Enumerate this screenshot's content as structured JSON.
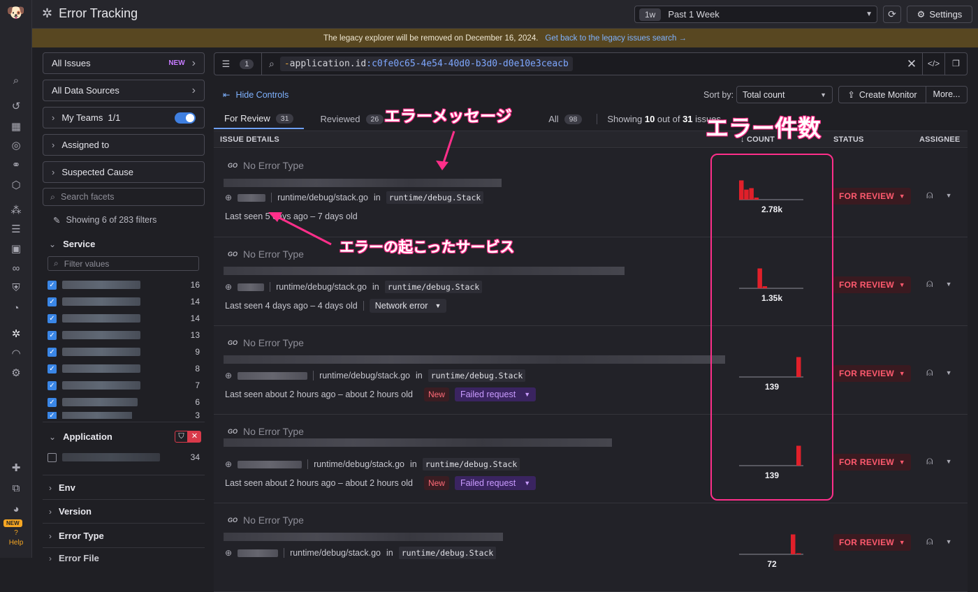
{
  "nav": {
    "new_badge": "NEW",
    "help_label": "Help",
    "icons": [
      "datadog-logo",
      "search-icon",
      "history-icon",
      "dashboard-icon",
      "target-icon",
      "binoculars-icon",
      "cube-icon",
      "service-icon",
      "logs-icon",
      "infra-icon",
      "link-icon",
      "security-icon",
      "apm-icon",
      "bug-icon",
      "gauge-icon",
      "synthetic-icon",
      "integrations-icon",
      "team-icon",
      "avatar"
    ]
  },
  "header": {
    "title": "Error Tracking",
    "time_pill": "1w",
    "time_label": "Past 1 Week",
    "settings_label": "Settings"
  },
  "banner": {
    "text": "The legacy explorer will be removed on December 16, 2024.",
    "link": "Get back to the legacy issues search →"
  },
  "sidebar": {
    "all_issues": "All Issues",
    "all_issues_badge": "NEW",
    "all_data_sources": "All Data Sources",
    "my_teams": "My Teams",
    "my_teams_count": "1/1",
    "assigned_to": "Assigned to",
    "suspected_cause": "Suspected Cause",
    "search_placeholder": "Search facets",
    "showing_filters": "Showing 6 of 283 filters",
    "service_label": "Service",
    "filter_placeholder": "Filter values",
    "service_counts": [
      "16",
      "14",
      "14",
      "13",
      "9",
      "8",
      "7",
      "6",
      "3"
    ],
    "application_label": "Application",
    "application_count": "34",
    "env_label": "Env",
    "version_label": "Version",
    "error_type_label": "Error Type",
    "error_file_label": "Error File"
  },
  "query": {
    "filter_count": "1",
    "minus": "-",
    "key": "application.id",
    "sep": ":",
    "value": "c0fe0c65-4e54-40d0-b3d0-d0e10e3ceacb"
  },
  "controls": {
    "hide_controls": "Hide Controls",
    "sort_by_label": "Sort by:",
    "sort_value": "Total count",
    "create_monitor": "Create Monitor",
    "more": "More..."
  },
  "tabs": [
    {
      "label": "For Review",
      "count": "31"
    },
    {
      "label": "Reviewed",
      "count": "26"
    },
    {
      "label": "All",
      "count": "98"
    }
  ],
  "showing": {
    "prefix": "Showing ",
    "shown": "10",
    "mid": " out of ",
    "total": "31",
    "suffix": " issues"
  },
  "table_headers": {
    "details": "ISSUE DETAILS",
    "count": "↓ COUNT",
    "status": "STATUS",
    "assignee": "ASSIGNEE"
  },
  "issues": [
    {
      "type": "No Error Type",
      "file": "runtime/debug/stack.go",
      "in": "in",
      "func": "runtime/debug.Stack",
      "seen": "Last seen 5 days ago – 7 days old",
      "count": "2.78k",
      "status": "FOR REVIEW",
      "spark": [
        0.92,
        0.48,
        0.55,
        0.1,
        0,
        0,
        0,
        0,
        0,
        0
      ]
    },
    {
      "type": "No Error Type",
      "file": "runtime/debug/stack.go",
      "in": "in",
      "func": "runtime/debug.Stack",
      "seen": "Last seen 4 days ago – 4 days old",
      "tag": "Network error",
      "count": "1.35k",
      "status": "FOR REVIEW",
      "spark": [
        0,
        0,
        0.95,
        0.1,
        0,
        0,
        0,
        0,
        0,
        0
      ]
    },
    {
      "type": "No Error Type",
      "file": "runtime/debug/stack.go",
      "in": "in",
      "func": "runtime/debug.Stack",
      "seen": "Last seen about 2 hours ago – about 2 hours old",
      "new": "New",
      "tag": "Failed request",
      "count": "139",
      "status": "FOR REVIEW",
      "spark": [
        0,
        0,
        0,
        0,
        0,
        0,
        0,
        0,
        0,
        0.95
      ]
    },
    {
      "type": "No Error Type",
      "file": "runtime/debug/stack.go",
      "in": "in",
      "func": "runtime/debug.Stack",
      "seen": "Last seen about 2 hours ago – about 2 hours old",
      "new": "New",
      "tag": "Failed request",
      "count": "139",
      "status": "FOR REVIEW",
      "spark": [
        0,
        0,
        0,
        0,
        0,
        0,
        0,
        0,
        0,
        0.95
      ]
    },
    {
      "type": "No Error Type",
      "file": "runtime/debug/stack.go",
      "in": "in",
      "func": "runtime/debug.Stack",
      "count": "72",
      "status": "FOR REVIEW",
      "spark": [
        0,
        0,
        0,
        0,
        0,
        0,
        0,
        0,
        0.95,
        0.05
      ]
    }
  ],
  "annotations": {
    "error_message": "エラーメッセージ",
    "error_count": "エラー件数",
    "error_service": "エラーの起こったサービス",
    "highlight_color": "#ff2f8a"
  },
  "colors": {
    "accent": "#3a86e6",
    "error_bar": "#e0202a",
    "status": "#ff5a6e",
    "banner": "#584721"
  }
}
